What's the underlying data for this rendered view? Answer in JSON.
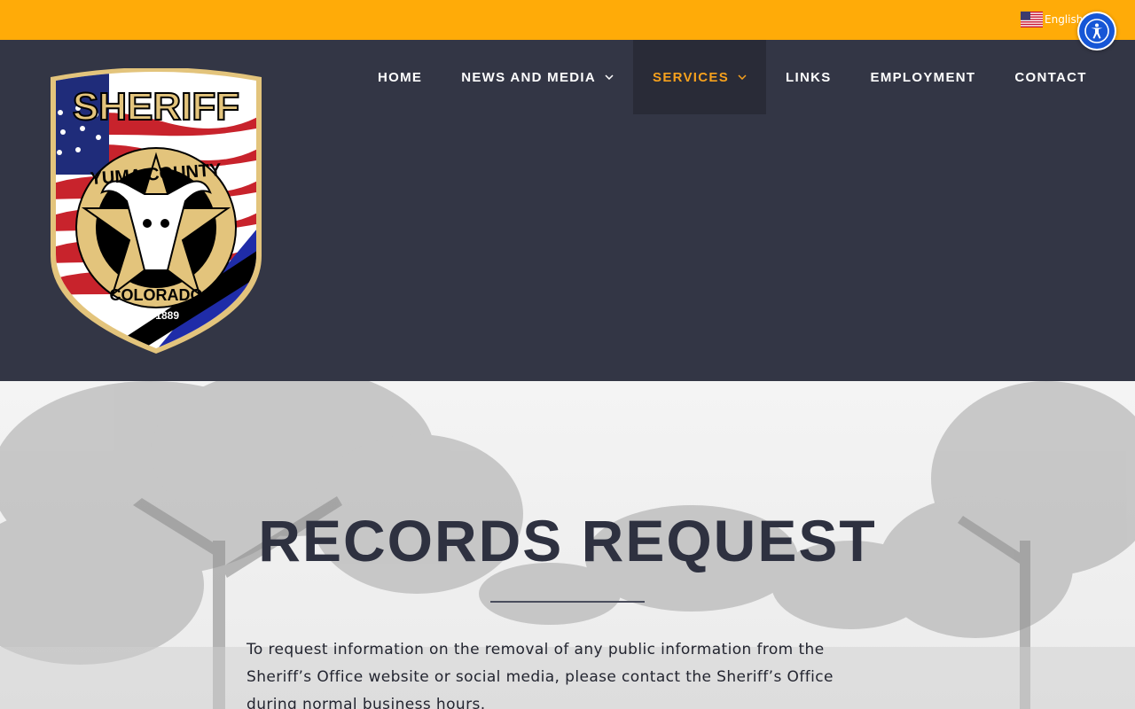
{
  "topbar": {
    "language_label": "English",
    "flag_icon": "us-flag-icon",
    "accessibility_icon": "accessibility-icon",
    "bg_color": "#ffab08"
  },
  "header": {
    "bg_color": "#333645",
    "logo": {
      "icon": "sheriff-badge-logo",
      "text_top": "SHERIFF",
      "text_county": "YUMA COUNTY",
      "text_state": "COLORADO",
      "text_est": "Est. 1889"
    },
    "nav": {
      "items": [
        {
          "label": "HOME",
          "dropdown": false,
          "active": false
        },
        {
          "label": "NEWS AND MEDIA",
          "dropdown": true,
          "active": false
        },
        {
          "label": "SERVICES",
          "dropdown": true,
          "active": true
        },
        {
          "label": "LINKS",
          "dropdown": false,
          "active": false
        },
        {
          "label": "EMPLOYMENT",
          "dropdown": false,
          "active": false
        },
        {
          "label": "CONTACT",
          "dropdown": false,
          "active": false
        }
      ],
      "active_color": "#f6a11d"
    }
  },
  "hero": {
    "title": "RECORDS REQUEST",
    "body": "To request information on the removal of any public information from the Sheriff’s Office website or social media, please contact the Sheriff’s Office during normal business hours."
  }
}
